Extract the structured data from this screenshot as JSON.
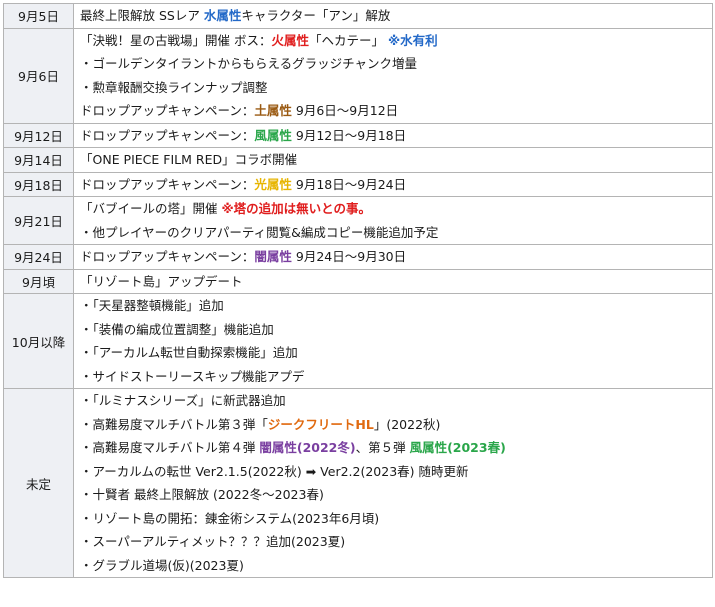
{
  "rows": [
    {
      "date": "9月5日",
      "lines": [
        [
          {
            "t": "最終上限解放 SSレア "
          },
          {
            "t": "水属性",
            "c": "blue",
            "b": true
          },
          {
            "t": "キャラクター「アン」解放"
          }
        ]
      ]
    },
    {
      "date": "9月6日",
      "lines": [
        [
          {
            "t": "「決戦！星の古戦場」開催 ボス："
          },
          {
            "t": "火属性",
            "c": "red",
            "b": true
          },
          {
            "t": "「ヘカテー」 "
          },
          {
            "t": "※水有利",
            "c": "blue",
            "b": true
          }
        ],
        [
          {
            "t": "・ゴールデンタイラントからもらえるグラッジチャンク増量"
          }
        ],
        [
          {
            "t": "・勲章報酬交換ラインナップ調整"
          }
        ],
        [
          {
            "t": "ドロップアップキャンペーン："
          },
          {
            "t": "土属性",
            "c": "brown",
            "b": true
          },
          {
            "t": " 9月6日～9月12日"
          }
        ]
      ]
    },
    {
      "date": "9月12日",
      "lines": [
        [
          {
            "t": "ドロップアップキャンペーン："
          },
          {
            "t": "風属性",
            "c": "green",
            "b": true
          },
          {
            "t": " 9月12日～9月18日"
          }
        ]
      ]
    },
    {
      "date": "9月14日",
      "lines": [
        [
          {
            "t": "「ONE PIECE FILM RED」コラボ開催"
          }
        ]
      ]
    },
    {
      "date": "9月18日",
      "lines": [
        [
          {
            "t": "ドロップアップキャンペーン："
          },
          {
            "t": "光属性",
            "c": "yellow",
            "b": true
          },
          {
            "t": " 9月18日～9月24日"
          }
        ]
      ]
    },
    {
      "date": "9月21日",
      "lines": [
        [
          {
            "t": "「バブイールの塔」開催 "
          },
          {
            "t": "※塔の追加は無いとの事。",
            "c": "red",
            "b": true
          }
        ],
        [
          {
            "t": "・他プレイヤーのクリアパーティ閲覧&編成コピー機能追加予定"
          }
        ]
      ]
    },
    {
      "date": "9月24日",
      "lines": [
        [
          {
            "t": "ドロップアップキャンペーン："
          },
          {
            "t": "闇属性",
            "c": "purple",
            "b": true
          },
          {
            "t": " 9月24日～9月30日"
          }
        ]
      ]
    },
    {
      "date": "9月頃",
      "lines": [
        [
          {
            "t": "「リゾート島」アップデート"
          }
        ]
      ]
    },
    {
      "date": "10月以降",
      "lines": [
        [
          {
            "t": "・「天星器整頓機能」追加"
          }
        ],
        [
          {
            "t": "・「装備の編成位置調整」機能追加"
          }
        ],
        [
          {
            "t": "・「アーカルム転世自動探索機能」追加"
          }
        ],
        [
          {
            "t": "・サイドストーリースキップ機能アプデ"
          }
        ]
      ]
    },
    {
      "date": "未定",
      "lines": [
        [
          {
            "t": "・「ルミナスシリーズ」に新武器追加"
          }
        ],
        [
          {
            "t": "・高難易度マルチバトル第３弾「"
          },
          {
            "t": "ジークフリートHL",
            "c": "orange",
            "b": true
          },
          {
            "t": "」(2022秋)"
          }
        ],
        [
          {
            "t": "・高難易度マルチバトル第４弾 "
          },
          {
            "t": "闇属性(2022冬)",
            "c": "purple",
            "b": true
          },
          {
            "t": "、第５弾 "
          },
          {
            "t": "風属性(2023春)",
            "c": "green",
            "b": true
          }
        ],
        [
          {
            "t": "・アーカルムの転世 Ver2.1.5(2022秋) ➡ Ver2.2(2023春) 随時更新"
          }
        ],
        [
          {
            "t": "・十賢者 最終上限解放 (2022冬～2023春)"
          }
        ],
        [
          {
            "t": "・リゾート島の開拓：錬金術システム(2023年6月頃)"
          }
        ],
        [
          {
            "t": "・スーパーアルティメット？？？追加(2023夏)"
          }
        ],
        [
          {
            "t": "・グラブル道場(仮)(2023夏)"
          }
        ]
      ]
    }
  ]
}
